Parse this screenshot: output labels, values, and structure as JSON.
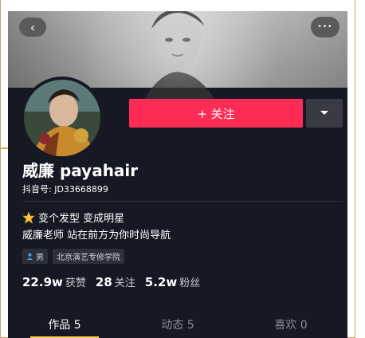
{
  "colors": {
    "accent": "#fe2c55",
    "background": "#161823",
    "tab_indicator": "#ffd24d",
    "frame_border": "#c7a36b"
  },
  "header": {
    "back_icon": "chevron-left-icon",
    "more_icon": "ellipsis-icon",
    "back_label": "‹",
    "more_label": "•••"
  },
  "profile": {
    "follow_label": "+ 关注",
    "dropdown_icon": "caret-down-icon",
    "name": "威廉 payahair",
    "douyin_id": "抖音号: JD33668899",
    "bio_line1": "变个发型 变成明星",
    "bio_line2": "威廉老师 站在前方为你时尚导航",
    "bio_icon": "star-icon",
    "tags": [
      {
        "icon": "person-icon",
        "label": "男"
      },
      {
        "label": "北京演艺专修学院"
      }
    ],
    "stats": [
      {
        "value": "22.9w",
        "label": "获赞"
      },
      {
        "value": "28",
        "label": "关注"
      },
      {
        "value": "5.2w",
        "label": "粉丝"
      }
    ]
  },
  "tabs": [
    {
      "label": "作品 5",
      "active": true
    },
    {
      "label": "动态 5",
      "active": false
    },
    {
      "label": "喜欢 0",
      "active": false
    }
  ]
}
